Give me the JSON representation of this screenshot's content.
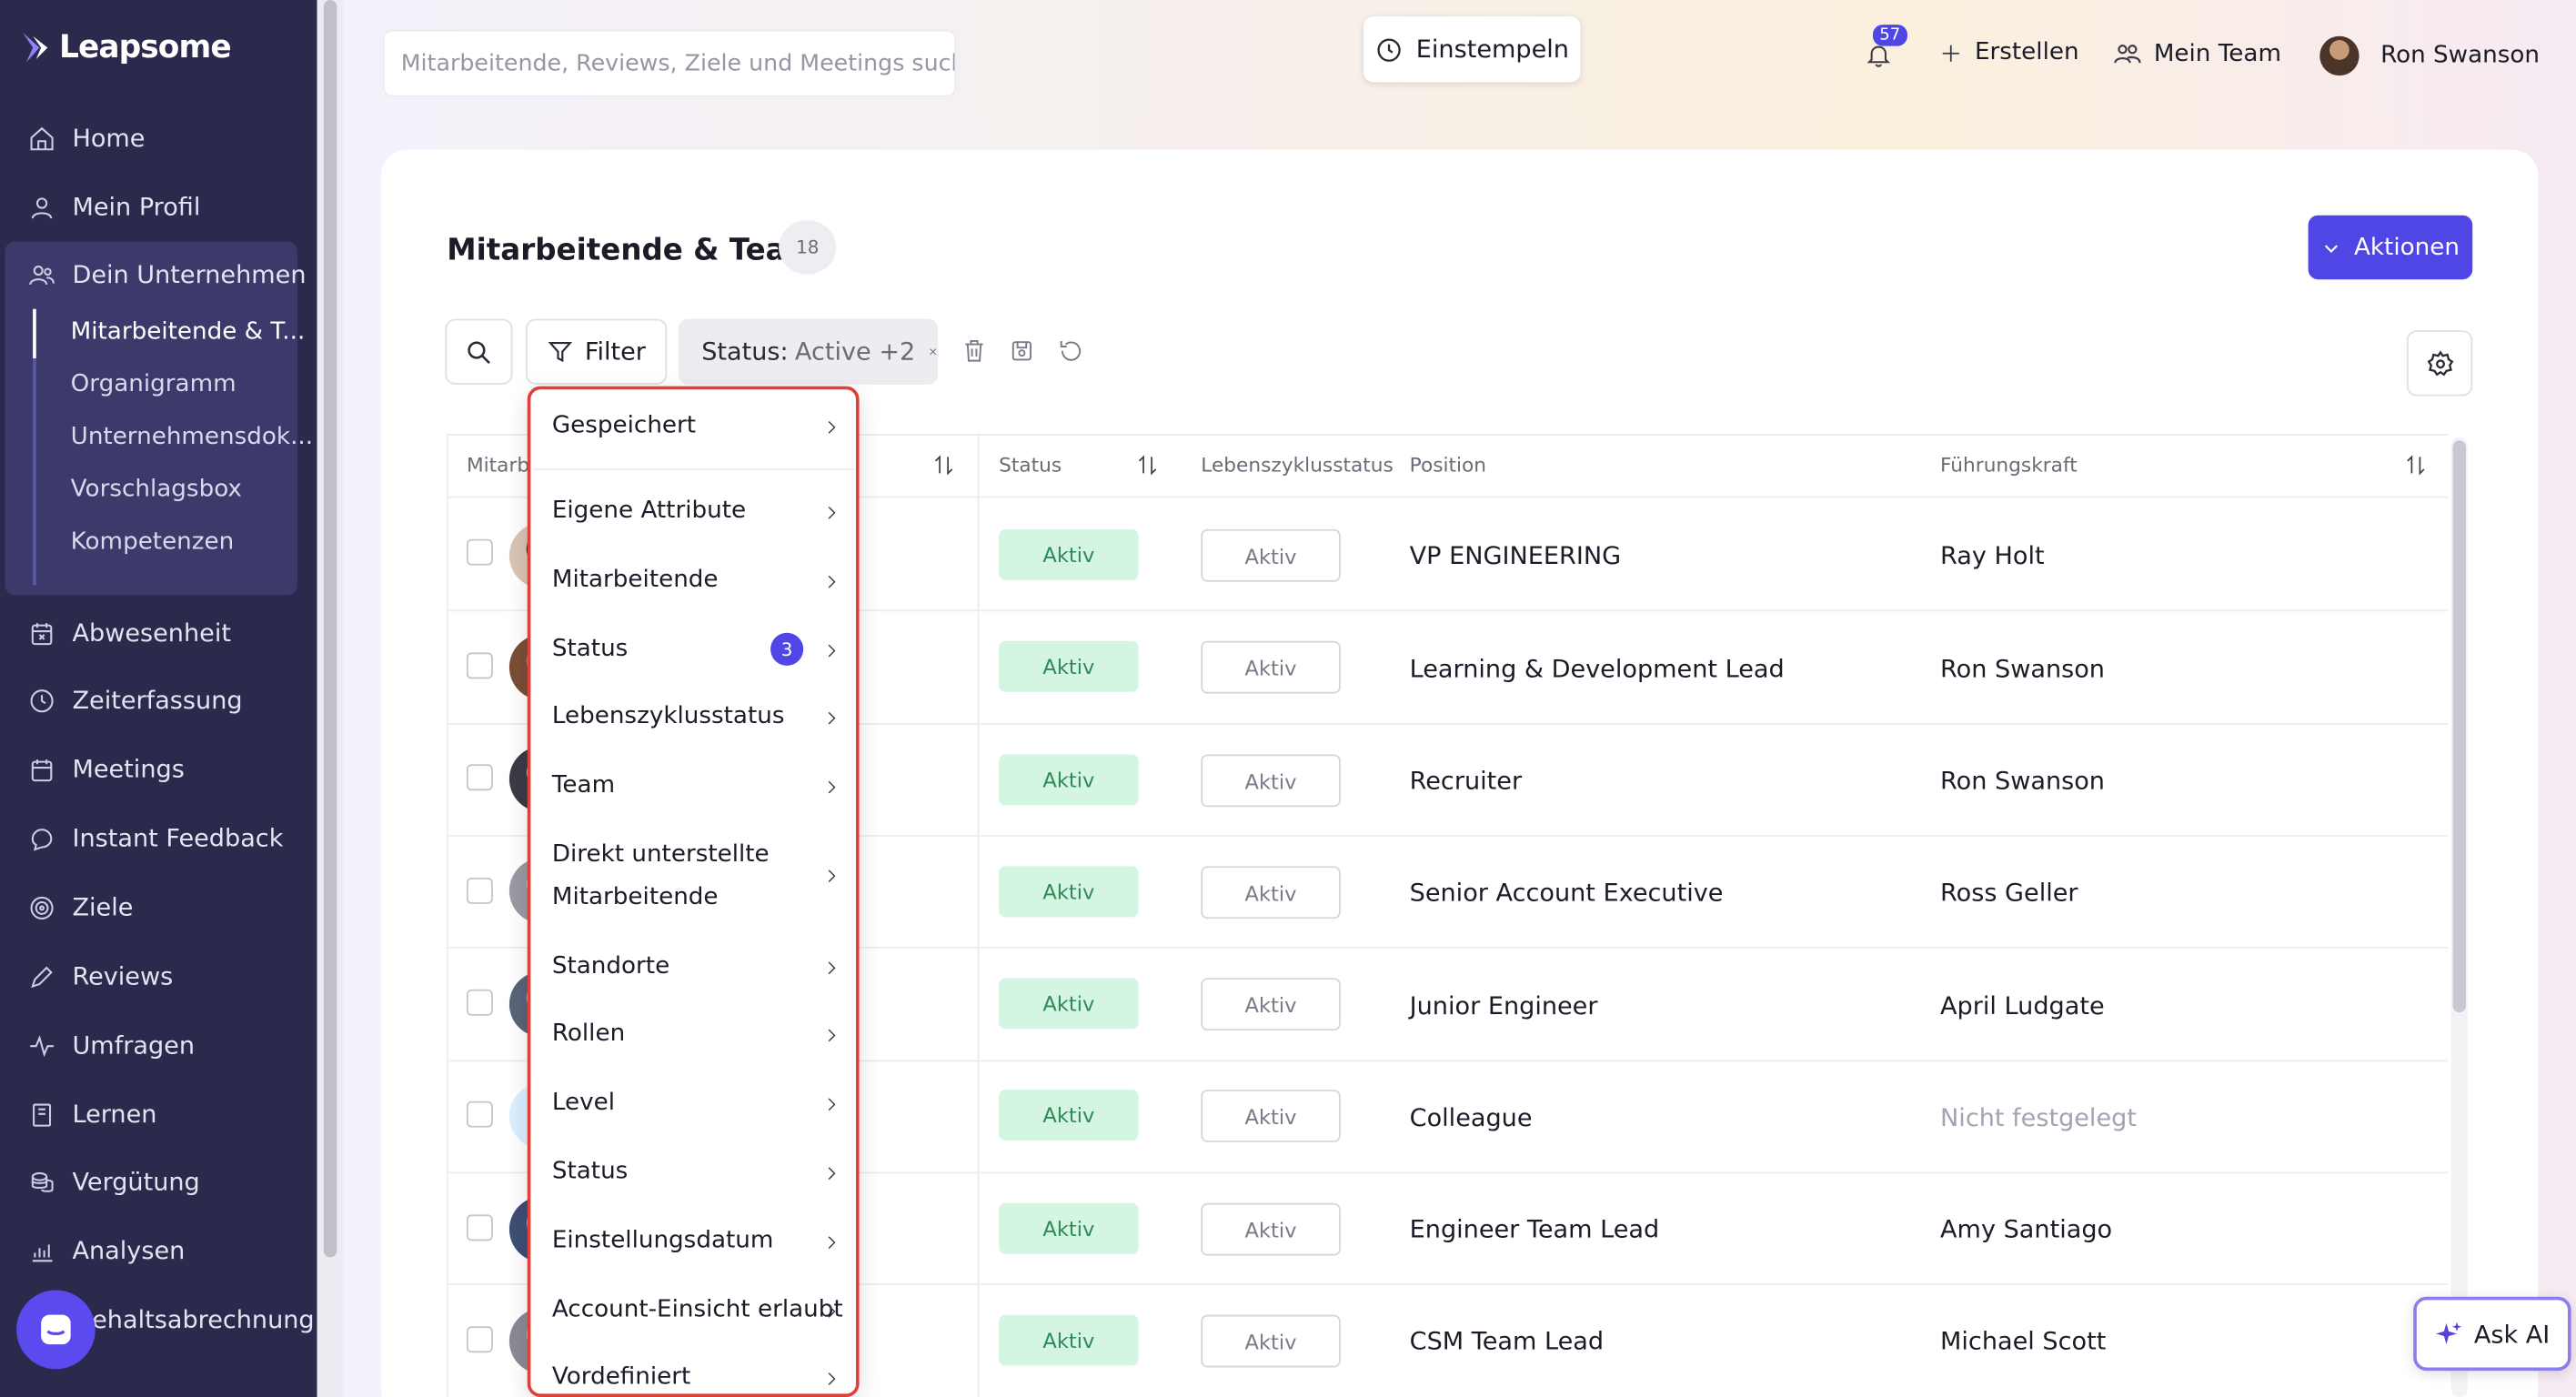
{
  "app": {
    "name": "Leapsome"
  },
  "colors": {
    "accent": "#4f46e5",
    "sidebar": "#2b2a4c",
    "status_green_bg": "#d5f5e3",
    "highlight_border": "#e0403a"
  },
  "sidebar": {
    "items": [
      {
        "label": "Home",
        "icon": "home-icon"
      },
      {
        "label": "Mein Profil",
        "icon": "user-icon"
      },
      {
        "label": "Dein Unternehmen",
        "icon": "users-icon"
      },
      {
        "label": "Abwesenheit",
        "icon": "calendar-x-icon"
      },
      {
        "label": "Zeiterfassung",
        "icon": "clock-icon"
      },
      {
        "label": "Meetings",
        "icon": "calendar-icon"
      },
      {
        "label": "Instant Feedback",
        "icon": "chat-icon"
      },
      {
        "label": "Ziele",
        "icon": "target-icon"
      },
      {
        "label": "Reviews",
        "icon": "pen-icon"
      },
      {
        "label": "Umfragen",
        "icon": "pulse-icon"
      },
      {
        "label": "Lernen",
        "icon": "book-icon"
      },
      {
        "label": "Vergütung",
        "icon": "coins-icon"
      },
      {
        "label": "Analysen",
        "icon": "chart-icon"
      },
      {
        "label": "ehaltsabrechnung",
        "icon": "payroll-icon"
      }
    ],
    "company_sub": [
      "Mitarbeitende & T...",
      "Organigramm",
      "Unternehmensdok...",
      "Vorschlagsbox",
      "Kompetenzen"
    ]
  },
  "topbar": {
    "search_placeholder": "Mitarbeitende, Reviews, Ziele und Meetings suche",
    "clock_in": "Einstempeln",
    "notifications_count": "57",
    "create": "Erstellen",
    "my_team": "Mein Team",
    "user_name": "Ron Swanson"
  },
  "page": {
    "title": "Mitarbeitende & Teams",
    "count": "18",
    "actions_button": "Aktionen",
    "filter_button": "Filter",
    "status_chip_key": "Status:",
    "status_chip_value": "Active +2"
  },
  "table": {
    "headers": {
      "employee": "Mitarb",
      "status": "Status",
      "lifecycle": "Lebenszyklusstatus",
      "position": "Position",
      "manager": "Führungskraft"
    },
    "rows": [
      {
        "status": "Aktiv",
        "lifecycle": "Aktiv",
        "position": "VP ENGINEERING",
        "manager": "Ray Holt"
      },
      {
        "status": "Aktiv",
        "lifecycle": "Aktiv",
        "position": "Learning & Development Lead",
        "manager": "Ron Swanson"
      },
      {
        "status": "Aktiv",
        "lifecycle": "Aktiv",
        "position": "Recruiter",
        "manager": "Ron Swanson"
      },
      {
        "status": "Aktiv",
        "lifecycle": "Aktiv",
        "position": "Senior Account Executive",
        "manager": "Ross Geller"
      },
      {
        "status": "Aktiv",
        "lifecycle": "Aktiv",
        "position": "Junior Engineer",
        "manager": "April Ludgate"
      },
      {
        "status": "Aktiv",
        "lifecycle": "Aktiv",
        "position": "Colleague",
        "manager": "Nicht festgelegt"
      },
      {
        "status": "Aktiv",
        "lifecycle": "Aktiv",
        "position": "Engineer Team Lead",
        "manager": "Amy Santiago"
      },
      {
        "status": "Aktiv",
        "lifecycle": "Aktiv",
        "position": "CSM Team Lead",
        "manager": "Michael Scott"
      }
    ]
  },
  "filter_menu": {
    "items": [
      "Gespeichert",
      "Eigene Attribute",
      "Mitarbeitende",
      "Status",
      "Lebenszyklusstatus",
      "Team",
      "Direkt unterstellte",
      "Mitarbeitende",
      "Standorte",
      "Rollen",
      "Level",
      "Status",
      "Einstellungsdatum",
      "Account-Einsicht erlaubt",
      "Vordefiniert"
    ],
    "status_badge": "3"
  },
  "ask_ai": "Ask AI"
}
